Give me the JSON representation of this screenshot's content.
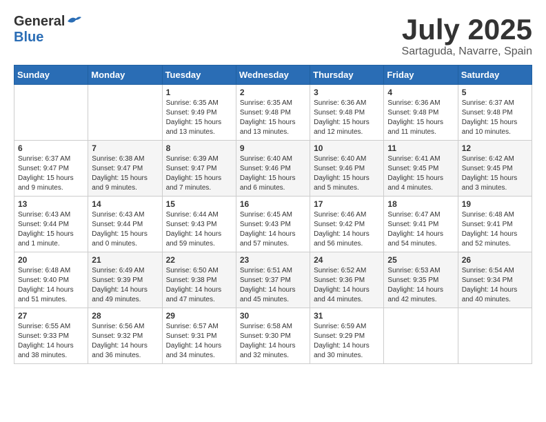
{
  "header": {
    "logo_general": "General",
    "logo_blue": "Blue",
    "month_title": "July 2025",
    "subtitle": "Sartaguda, Navarre, Spain"
  },
  "calendar": {
    "days_of_week": [
      "Sunday",
      "Monday",
      "Tuesday",
      "Wednesday",
      "Thursday",
      "Friday",
      "Saturday"
    ],
    "weeks": [
      [
        {
          "day": "",
          "sunrise": "",
          "sunset": "",
          "daylight": ""
        },
        {
          "day": "",
          "sunrise": "",
          "sunset": "",
          "daylight": ""
        },
        {
          "day": "1",
          "sunrise": "Sunrise: 6:35 AM",
          "sunset": "Sunset: 9:49 PM",
          "daylight": "Daylight: 15 hours and 13 minutes."
        },
        {
          "day": "2",
          "sunrise": "Sunrise: 6:35 AM",
          "sunset": "Sunset: 9:48 PM",
          "daylight": "Daylight: 15 hours and 13 minutes."
        },
        {
          "day": "3",
          "sunrise": "Sunrise: 6:36 AM",
          "sunset": "Sunset: 9:48 PM",
          "daylight": "Daylight: 15 hours and 12 minutes."
        },
        {
          "day": "4",
          "sunrise": "Sunrise: 6:36 AM",
          "sunset": "Sunset: 9:48 PM",
          "daylight": "Daylight: 15 hours and 11 minutes."
        },
        {
          "day": "5",
          "sunrise": "Sunrise: 6:37 AM",
          "sunset": "Sunset: 9:48 PM",
          "daylight": "Daylight: 15 hours and 10 minutes."
        }
      ],
      [
        {
          "day": "6",
          "sunrise": "Sunrise: 6:37 AM",
          "sunset": "Sunset: 9:47 PM",
          "daylight": "Daylight: 15 hours and 9 minutes."
        },
        {
          "day": "7",
          "sunrise": "Sunrise: 6:38 AM",
          "sunset": "Sunset: 9:47 PM",
          "daylight": "Daylight: 15 hours and 9 minutes."
        },
        {
          "day": "8",
          "sunrise": "Sunrise: 6:39 AM",
          "sunset": "Sunset: 9:47 PM",
          "daylight": "Daylight: 15 hours and 7 minutes."
        },
        {
          "day": "9",
          "sunrise": "Sunrise: 6:40 AM",
          "sunset": "Sunset: 9:46 PM",
          "daylight": "Daylight: 15 hours and 6 minutes."
        },
        {
          "day": "10",
          "sunrise": "Sunrise: 6:40 AM",
          "sunset": "Sunset: 9:46 PM",
          "daylight": "Daylight: 15 hours and 5 minutes."
        },
        {
          "day": "11",
          "sunrise": "Sunrise: 6:41 AM",
          "sunset": "Sunset: 9:45 PM",
          "daylight": "Daylight: 15 hours and 4 minutes."
        },
        {
          "day": "12",
          "sunrise": "Sunrise: 6:42 AM",
          "sunset": "Sunset: 9:45 PM",
          "daylight": "Daylight: 15 hours and 3 minutes."
        }
      ],
      [
        {
          "day": "13",
          "sunrise": "Sunrise: 6:43 AM",
          "sunset": "Sunset: 9:44 PM",
          "daylight": "Daylight: 15 hours and 1 minute."
        },
        {
          "day": "14",
          "sunrise": "Sunrise: 6:43 AM",
          "sunset": "Sunset: 9:44 PM",
          "daylight": "Daylight: 15 hours and 0 minutes."
        },
        {
          "day": "15",
          "sunrise": "Sunrise: 6:44 AM",
          "sunset": "Sunset: 9:43 PM",
          "daylight": "Daylight: 14 hours and 59 minutes."
        },
        {
          "day": "16",
          "sunrise": "Sunrise: 6:45 AM",
          "sunset": "Sunset: 9:43 PM",
          "daylight": "Daylight: 14 hours and 57 minutes."
        },
        {
          "day": "17",
          "sunrise": "Sunrise: 6:46 AM",
          "sunset": "Sunset: 9:42 PM",
          "daylight": "Daylight: 14 hours and 56 minutes."
        },
        {
          "day": "18",
          "sunrise": "Sunrise: 6:47 AM",
          "sunset": "Sunset: 9:41 PM",
          "daylight": "Daylight: 14 hours and 54 minutes."
        },
        {
          "day": "19",
          "sunrise": "Sunrise: 6:48 AM",
          "sunset": "Sunset: 9:41 PM",
          "daylight": "Daylight: 14 hours and 52 minutes."
        }
      ],
      [
        {
          "day": "20",
          "sunrise": "Sunrise: 6:48 AM",
          "sunset": "Sunset: 9:40 PM",
          "daylight": "Daylight: 14 hours and 51 minutes."
        },
        {
          "day": "21",
          "sunrise": "Sunrise: 6:49 AM",
          "sunset": "Sunset: 9:39 PM",
          "daylight": "Daylight: 14 hours and 49 minutes."
        },
        {
          "day": "22",
          "sunrise": "Sunrise: 6:50 AM",
          "sunset": "Sunset: 9:38 PM",
          "daylight": "Daylight: 14 hours and 47 minutes."
        },
        {
          "day": "23",
          "sunrise": "Sunrise: 6:51 AM",
          "sunset": "Sunset: 9:37 PM",
          "daylight": "Daylight: 14 hours and 45 minutes."
        },
        {
          "day": "24",
          "sunrise": "Sunrise: 6:52 AM",
          "sunset": "Sunset: 9:36 PM",
          "daylight": "Daylight: 14 hours and 44 minutes."
        },
        {
          "day": "25",
          "sunrise": "Sunrise: 6:53 AM",
          "sunset": "Sunset: 9:35 PM",
          "daylight": "Daylight: 14 hours and 42 minutes."
        },
        {
          "day": "26",
          "sunrise": "Sunrise: 6:54 AM",
          "sunset": "Sunset: 9:34 PM",
          "daylight": "Daylight: 14 hours and 40 minutes."
        }
      ],
      [
        {
          "day": "27",
          "sunrise": "Sunrise: 6:55 AM",
          "sunset": "Sunset: 9:33 PM",
          "daylight": "Daylight: 14 hours and 38 minutes."
        },
        {
          "day": "28",
          "sunrise": "Sunrise: 6:56 AM",
          "sunset": "Sunset: 9:32 PM",
          "daylight": "Daylight: 14 hours and 36 minutes."
        },
        {
          "day": "29",
          "sunrise": "Sunrise: 6:57 AM",
          "sunset": "Sunset: 9:31 PM",
          "daylight": "Daylight: 14 hours and 34 minutes."
        },
        {
          "day": "30",
          "sunrise": "Sunrise: 6:58 AM",
          "sunset": "Sunset: 9:30 PM",
          "daylight": "Daylight: 14 hours and 32 minutes."
        },
        {
          "day": "31",
          "sunrise": "Sunrise: 6:59 AM",
          "sunset": "Sunset: 9:29 PM",
          "daylight": "Daylight: 14 hours and 30 minutes."
        },
        {
          "day": "",
          "sunrise": "",
          "sunset": "",
          "daylight": ""
        },
        {
          "day": "",
          "sunrise": "",
          "sunset": "",
          "daylight": ""
        }
      ]
    ]
  }
}
